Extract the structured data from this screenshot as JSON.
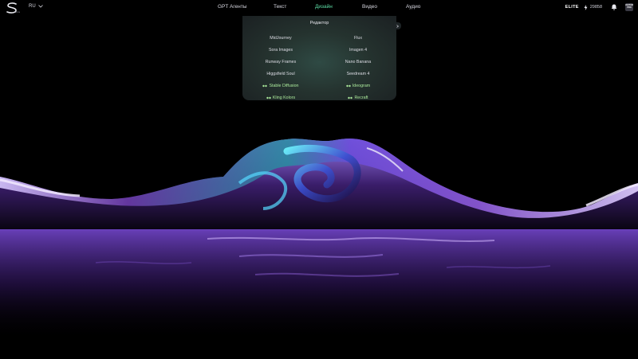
{
  "brand": {
    "logo_text": "Sora"
  },
  "language": {
    "current": "RU"
  },
  "nav": {
    "items": [
      {
        "label": "GPT Агенты",
        "active": false
      },
      {
        "label": "Текст",
        "active": false
      },
      {
        "label": "Дизайн",
        "active": true
      },
      {
        "label": "Видео",
        "active": false
      },
      {
        "label": "Аудио",
        "active": false
      }
    ]
  },
  "account": {
    "tier": "ELITE",
    "credits": "29858",
    "avatar_text": "AVATAR PRO"
  },
  "design_menu": {
    "title": "Редактор",
    "left": [
      {
        "label": "MidJourney",
        "special": false
      },
      {
        "label": "Sora Images",
        "special": false
      },
      {
        "label": "Runway Frames",
        "special": false
      },
      {
        "label": "Higgsfield Soul",
        "special": false
      },
      {
        "label": "Stable Diffusion",
        "special": true
      },
      {
        "label": "Kling Kolors",
        "special": true
      }
    ],
    "right": [
      {
        "label": "Flux",
        "special": false
      },
      {
        "label": "Imagen 4",
        "special": false
      },
      {
        "label": "Nano Banana",
        "special": false
      },
      {
        "label": "Seedream 4",
        "special": false
      },
      {
        "label": "Ideogram",
        "special": true
      },
      {
        "label": "Recraft",
        "special": true
      }
    ]
  },
  "colors": {
    "accent": "#5fe0a8",
    "special_item": "#a9e89a",
    "background": "#000000"
  }
}
